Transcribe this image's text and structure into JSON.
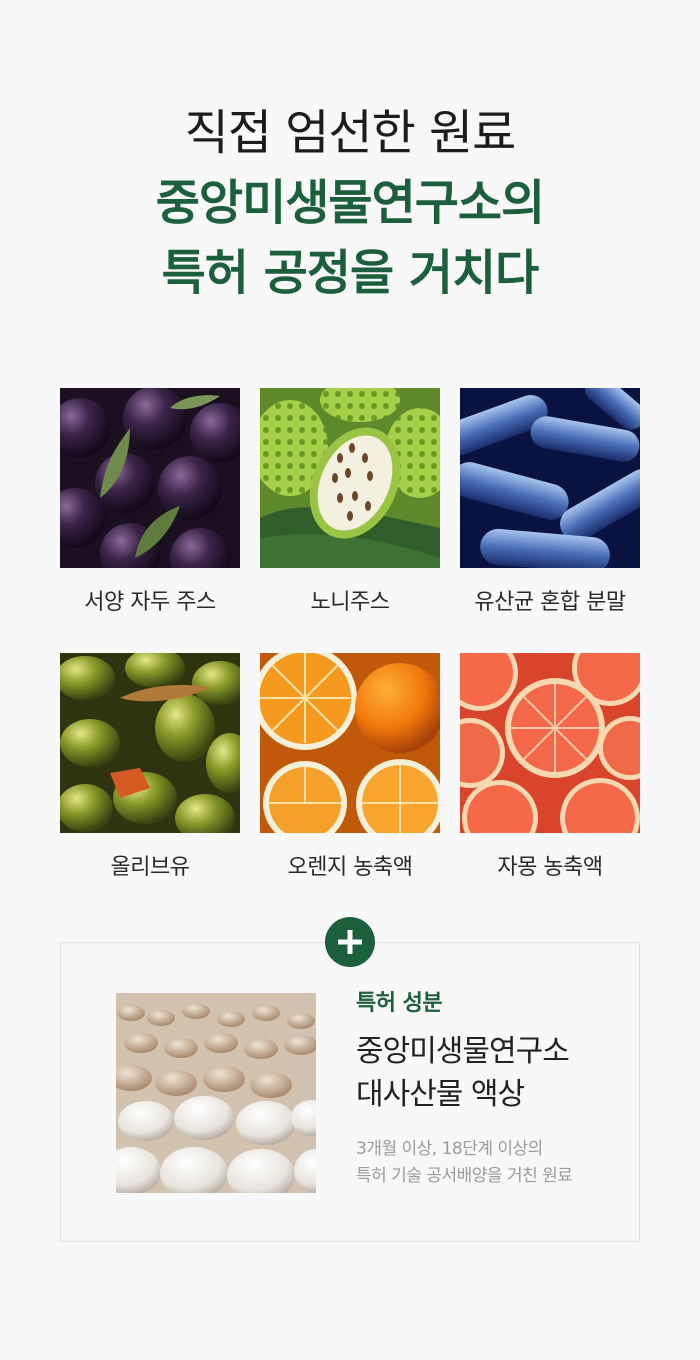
{
  "headline": {
    "line1": "직접 엄선한 원료",
    "line2": "중앙미생물연구소의",
    "line3": "특허 공정을 거치다"
  },
  "ingredients": [
    {
      "label": "서양 자두 주스",
      "icon": "plum-photo"
    },
    {
      "label": "노니주스",
      "icon": "noni-photo"
    },
    {
      "label": "유산균 혼합 분말",
      "icon": "lactobacillus-photo"
    },
    {
      "label": "올리브유",
      "icon": "olive-photo"
    },
    {
      "label": "오렌지 농축액",
      "icon": "orange-photo"
    },
    {
      "label": "자몽 농축액",
      "icon": "grapefruit-photo"
    }
  ],
  "patent": {
    "icon": "plus-icon",
    "tag": "특허 성분",
    "title_line1": "중앙미생물연구소",
    "title_line2": "대사산물 액상",
    "desc_line1": "3개월 이상, 18단계 이상의",
    "desc_line2": "특허 기술 공서배양을 거친 원료"
  },
  "colors": {
    "brand_green": "#1c5f3d",
    "background": "#f8f8f8",
    "muted_text": "#9a9a9a"
  }
}
